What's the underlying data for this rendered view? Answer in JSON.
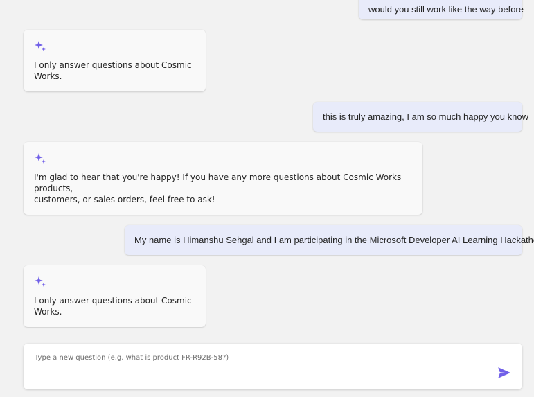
{
  "colors": {
    "accent": "#7160e8",
    "user_bubble": "#e8ebfa",
    "bot_card": "#f9f9f9",
    "background": "#f2f2f2"
  },
  "messages": [
    {
      "role": "user",
      "text": "would you still work like the way before"
    },
    {
      "role": "assistant",
      "icon": "sparkle-icon",
      "text": "I only answer questions about Cosmic Works."
    },
    {
      "role": "user",
      "text": "this is truly amazing, I am so much happy you know"
    },
    {
      "role": "assistant",
      "icon": "sparkle-icon",
      "text": "I'm glad to hear that you're happy! If you have any more questions about Cosmic Works products,\ncustomers, or sales orders, feel free to ask!"
    },
    {
      "role": "user",
      "text": "My name is Himanshu Sehgal and I am participating in the Microsoft Developer AI Learning Hackathon."
    },
    {
      "role": "assistant",
      "icon": "sparkle-icon",
      "text": "I only answer questions about Cosmic Works."
    }
  ],
  "composer": {
    "placeholder": "Type a new question (e.g. what is product FR-R92B-58?)",
    "value": "",
    "send_icon": "send-icon"
  }
}
